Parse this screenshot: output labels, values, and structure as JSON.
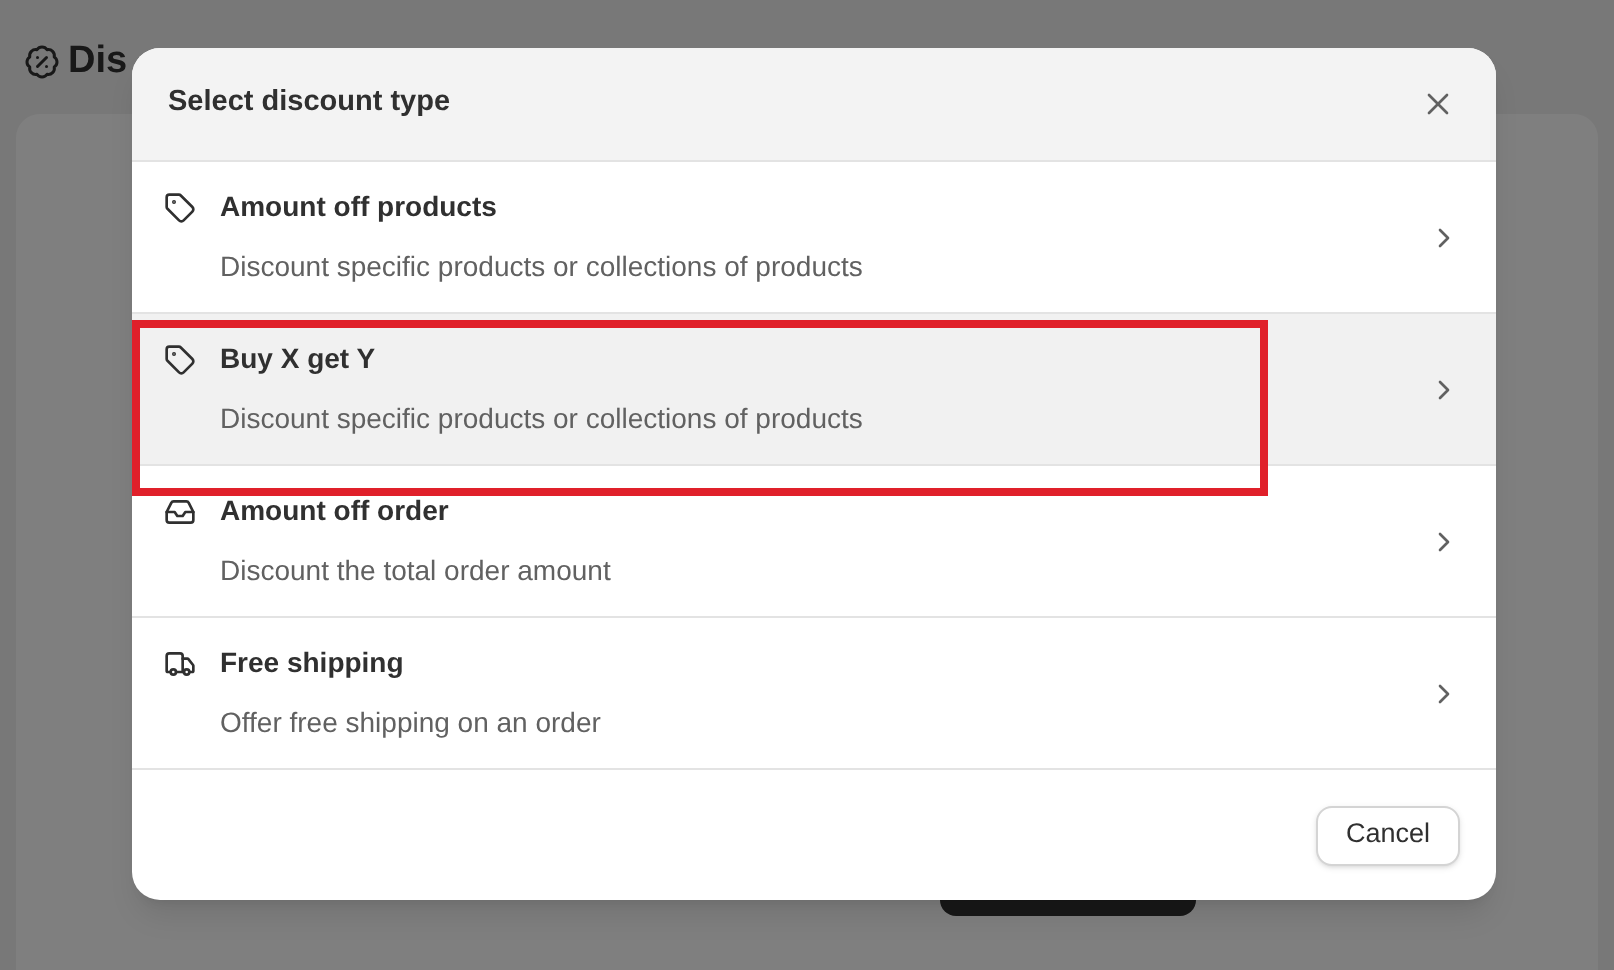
{
  "page": {
    "title": "Dis"
  },
  "dialog": {
    "title": "Select discount type",
    "options": [
      {
        "kind": "tag",
        "title": "Amount off products",
        "description": "Discount specific products or collections of products",
        "selected": false
      },
      {
        "kind": "tag",
        "title": "Buy X get Y",
        "description": "Discount specific products or collections of products",
        "selected": true
      },
      {
        "kind": "order",
        "title": "Amount off order",
        "description": "Discount the total order amount",
        "selected": false
      },
      {
        "kind": "shipping",
        "title": "Free shipping",
        "description": "Offer free shipping on an order",
        "selected": false
      }
    ],
    "cancel_button": "Cancel"
  }
}
